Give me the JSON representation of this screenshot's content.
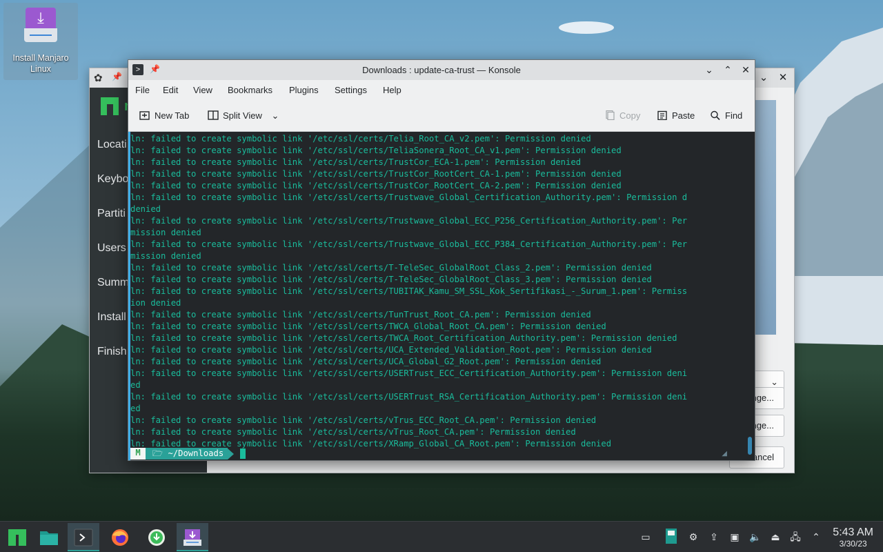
{
  "desktop": {
    "icon_label": "Install Manjaro Linux"
  },
  "installer": {
    "sidebar_steps": [
      "Locati",
      "Keybo",
      "Partiti",
      "Users",
      "Summ",
      "Install",
      "Finish"
    ],
    "logo_text": "m",
    "combo_arrow": "⌄",
    "button_1": "nge...",
    "button_2": "nge...",
    "cancel_label": "Cancel"
  },
  "konsole": {
    "title": "Downloads : update-ca-trust — Konsole",
    "menu": [
      "File",
      "Edit",
      "View",
      "Bookmarks",
      "Plugins",
      "Settings",
      "Help"
    ],
    "toolbar": {
      "new_tab": "New Tab",
      "split_view": "Split View",
      "copy": "Copy",
      "paste": "Paste",
      "find": "Find"
    },
    "terminal_lines": [
      "ln: failed to create symbolic link '/etc/ssl/certs/Telia_Root_CA_v2.pem': Permission denied",
      "ln: failed to create symbolic link '/etc/ssl/certs/TeliaSonera_Root_CA_v1.pem': Permission denied",
      "ln: failed to create symbolic link '/etc/ssl/certs/TrustCor_ECA-1.pem': Permission denied",
      "ln: failed to create symbolic link '/etc/ssl/certs/TrustCor_RootCert_CA-1.pem': Permission denied",
      "ln: failed to create symbolic link '/etc/ssl/certs/TrustCor_RootCert_CA-2.pem': Permission denied",
      "ln: failed to create symbolic link '/etc/ssl/certs/Trustwave_Global_Certification_Authority.pem': Permission d",
      "denied",
      "ln: failed to create symbolic link '/etc/ssl/certs/Trustwave_Global_ECC_P256_Certification_Authority.pem': Per",
      "mission denied",
      "ln: failed to create symbolic link '/etc/ssl/certs/Trustwave_Global_ECC_P384_Certification_Authority.pem': Per",
      "mission denied",
      "ln: failed to create symbolic link '/etc/ssl/certs/T-TeleSec_GlobalRoot_Class_2.pem': Permission denied",
      "ln: failed to create symbolic link '/etc/ssl/certs/T-TeleSec_GlobalRoot_Class_3.pem': Permission denied",
      "ln: failed to create symbolic link '/etc/ssl/certs/TUBITAK_Kamu_SM_SSL_Kok_Sertifikasi_-_Surum_1.pem': Permiss",
      "ion denied",
      "ln: failed to create symbolic link '/etc/ssl/certs/TunTrust_Root_CA.pem': Permission denied",
      "ln: failed to create symbolic link '/etc/ssl/certs/TWCA_Global_Root_CA.pem': Permission denied",
      "ln: failed to create symbolic link '/etc/ssl/certs/TWCA_Root_Certification_Authority.pem': Permission denied",
      "ln: failed to create symbolic link '/etc/ssl/certs/UCA_Extended_Validation_Root.pem': Permission denied",
      "ln: failed to create symbolic link '/etc/ssl/certs/UCA_Global_G2_Root.pem': Permission denied",
      "ln: failed to create symbolic link '/etc/ssl/certs/USERTrust_ECC_Certification_Authority.pem': Permission deni",
      "ed",
      "ln: failed to create symbolic link '/etc/ssl/certs/USERTrust_RSA_Certification_Authority.pem': Permission deni",
      "ed",
      "ln: failed to create symbolic link '/etc/ssl/certs/vTrus_ECC_Root_CA.pem': Permission denied",
      "ln: failed to create symbolic link '/etc/ssl/certs/vTrus_Root_CA.pem': Permission denied",
      "ln: failed to create symbolic link '/etc/ssl/certs/XRamp_Global_CA_Root.pem': Permission denied"
    ],
    "prompt_dir": "~/Downloads",
    "prompt_icon": "M",
    "colors": {
      "terminal_bg": "#232629",
      "terminal_text": "#1abc9c",
      "prompt_segment": "#2aa198",
      "accent": "#3daee9"
    }
  },
  "taskbar": {
    "clock_time": "5:43 AM",
    "clock_date": "3/30/23",
    "apps": [
      "manjaro-menu-icon",
      "file-manager-icon",
      "konsole-icon",
      "firefox-icon",
      "software-update-icon",
      "installer-icon"
    ],
    "tray_icons": [
      "show-desktop-icon",
      "clipboard-icon",
      "kde-connect-icon",
      "updates-icon",
      "terminal-tray-icon",
      "volume-icon",
      "usb-icon",
      "network-icon",
      "tray-expand-icon"
    ]
  }
}
